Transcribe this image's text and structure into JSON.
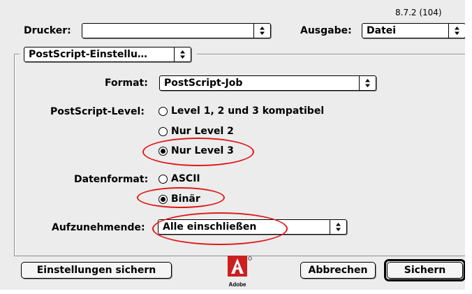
{
  "version": "8.7.2 (104)",
  "printer": {
    "label": "Drucker:",
    "value": ""
  },
  "output": {
    "label": "Ausgabe:",
    "value": "Datei"
  },
  "section_popup": {
    "value": "PostScript-Einstellu…"
  },
  "format": {
    "label": "Format:",
    "value": "PostScript-Job"
  },
  "ps_level": {
    "label": "PostScript-Level:",
    "options": [
      {
        "label": "Level 1, 2 und 3 kompatibel",
        "selected": false
      },
      {
        "label": "Nur Level 2",
        "selected": false
      },
      {
        "label": "Nur Level 3",
        "selected": true
      }
    ]
  },
  "data_format": {
    "label": "Datenformat:",
    "options": [
      {
        "label": "ASCII",
        "selected": false
      },
      {
        "label": "Binär",
        "selected": true
      }
    ]
  },
  "include": {
    "label": "Aufzunehmende:",
    "value": "Alle einschließen"
  },
  "buttons": {
    "save_settings": "Einstellungen sichern",
    "cancel": "Abbrechen",
    "save": "Sichern"
  },
  "logo": {
    "text": "Adobe"
  },
  "colors": {
    "annotation": "#e01818"
  },
  "icons": {
    "popup_arrows": "up-down-arrows-icon",
    "logo": "adobe-logo-icon"
  }
}
